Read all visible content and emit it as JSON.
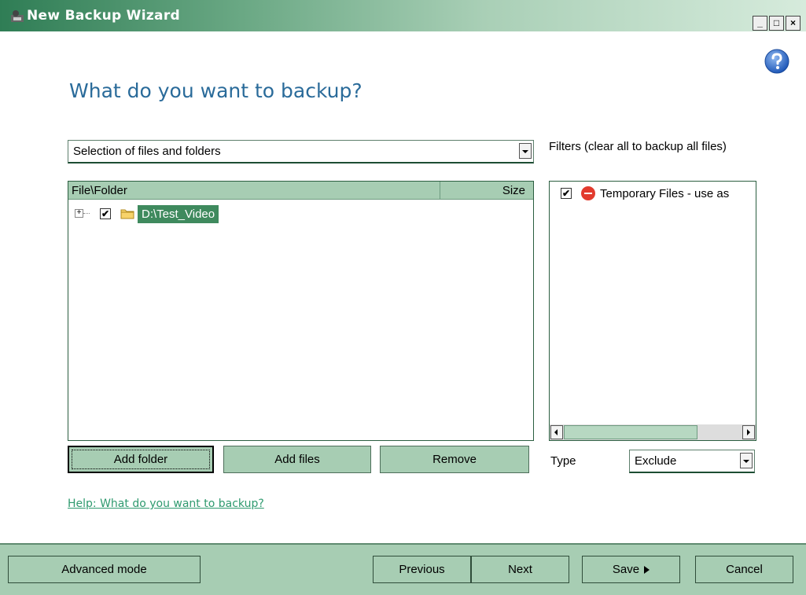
{
  "window": {
    "title": "New Backup Wizard",
    "minimize_label": "_",
    "maximize_label": "□",
    "close_label": "×"
  },
  "heading": "What do you want to backup?",
  "source_select": {
    "value": "Selection of files and folders"
  },
  "tree": {
    "columns": [
      "File\\Folder",
      "Size"
    ],
    "items": [
      {
        "expander": "+",
        "checked": true,
        "label": "D:\\Test_Video"
      }
    ]
  },
  "buttons": {
    "add_folder": "Add folder",
    "add_files": "Add files",
    "remove": "Remove"
  },
  "filters": {
    "label": "Filters (clear all to backup all files)",
    "items": [
      {
        "checked": true,
        "label": "Temporary Files - use as"
      }
    ],
    "type_label": "Type",
    "type_value": "Exclude"
  },
  "help_link": "Help: What do you want to backup?",
  "footer": {
    "advanced": "Advanced mode",
    "previous": "Previous",
    "next": "Next",
    "save": "Save",
    "cancel": "Cancel"
  },
  "colors": {
    "accent": "#a7cdb3",
    "selection": "#3f8a5e",
    "heading": "#2a6b9a",
    "link": "#2f9a6f"
  }
}
